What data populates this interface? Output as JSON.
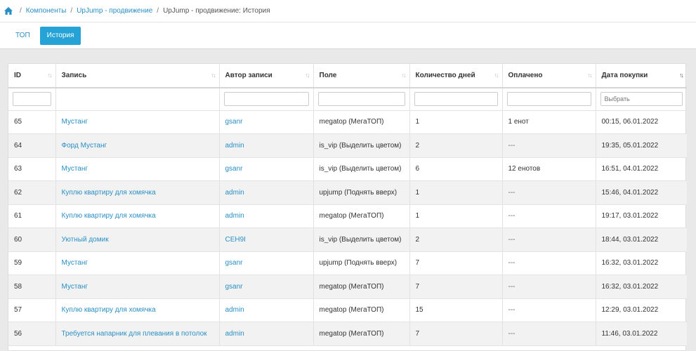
{
  "breadcrumb": {
    "items": [
      "Компоненты",
      "UpJump - продвижение"
    ],
    "current": "UpJump - продвижение: История"
  },
  "tabs": [
    {
      "label": "ТОП",
      "active": false
    },
    {
      "label": "История",
      "active": true
    }
  ],
  "table": {
    "columns": [
      "ID",
      "Запись",
      "Автор записи",
      "Поле",
      "Количество дней",
      "Оплачено",
      "Дата покупки"
    ],
    "date_filter_placeholder": "Выбрать",
    "rows": [
      {
        "id": "65",
        "record": "Мустанг",
        "author": "gsanr",
        "field": "megatop (МегаТОП)",
        "days": "1",
        "paid": "1 енот",
        "date": "00:15, 06.01.2022"
      },
      {
        "id": "64",
        "record": "Форд Мустанг",
        "author": "admin",
        "field": "is_vip (Выделить цветом)",
        "days": "2",
        "paid": "---",
        "date": "19:35, 05.01.2022"
      },
      {
        "id": "63",
        "record": "Мустанг",
        "author": "gsanr",
        "field": "is_vip (Выделить цветом)",
        "days": "6",
        "paid": "12 енотов",
        "date": "16:51, 04.01.2022"
      },
      {
        "id": "62",
        "record": "Куплю квартиру для хомячка",
        "author": "admin",
        "field": "upjump (Поднять вверх)",
        "days": "1",
        "paid": "---",
        "date": "15:46, 04.01.2022"
      },
      {
        "id": "61",
        "record": "Куплю квартиру для хомячка",
        "author": "admin",
        "field": "megatop (МегаТОП)",
        "days": "1",
        "paid": "---",
        "date": "19:17, 03.01.2022"
      },
      {
        "id": "60",
        "record": "Уютный домик",
        "author": "CEH9I",
        "field": "is_vip (Выделить цветом)",
        "days": "2",
        "paid": "---",
        "date": "18:44, 03.01.2022"
      },
      {
        "id": "59",
        "record": "Мустанг",
        "author": "gsanr",
        "field": "upjump (Поднять вверх)",
        "days": "7",
        "paid": "---",
        "date": "16:32, 03.01.2022"
      },
      {
        "id": "58",
        "record": "Мустанг",
        "author": "gsanr",
        "field": "megatop (МегаТОП)",
        "days": "7",
        "paid": "---",
        "date": "16:32, 03.01.2022"
      },
      {
        "id": "57",
        "record": "Куплю квартиру для хомячка",
        "author": "admin",
        "field": "megatop (МегаТОП)",
        "days": "15",
        "paid": "---",
        "date": "12:29, 03.01.2022"
      },
      {
        "id": "56",
        "record": "Требуется напарник для плевания в потолок",
        "author": "admin",
        "field": "megatop (МегаТОП)",
        "days": "7",
        "paid": "---",
        "date": "11:46, 03.01.2022"
      }
    ]
  }
}
